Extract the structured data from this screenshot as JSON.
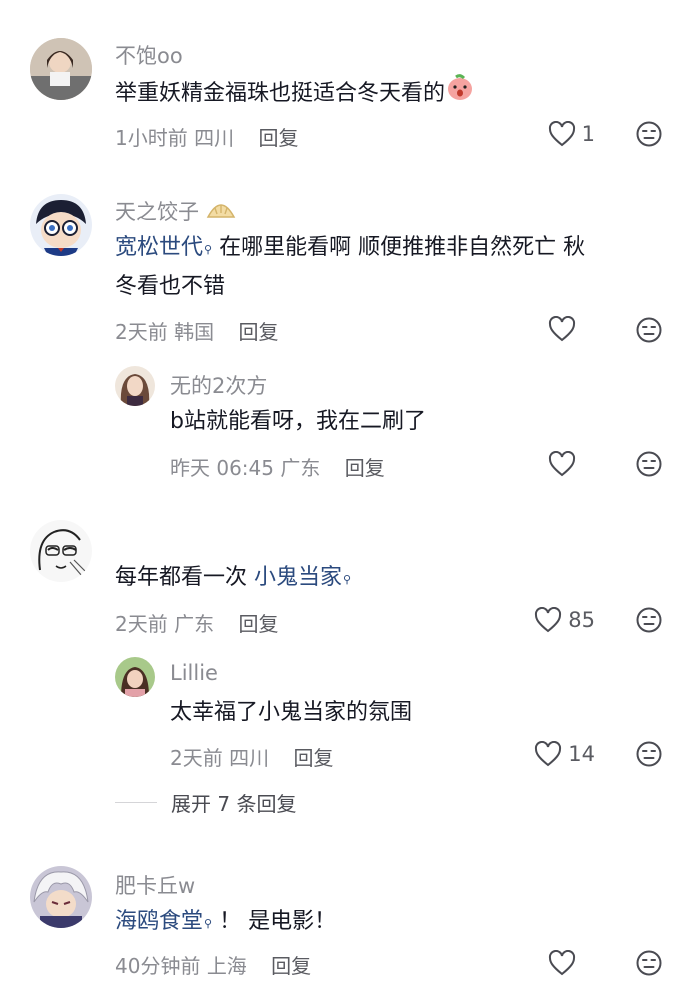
{
  "comments": [
    {
      "username": "不饱oo",
      "text": "举重妖精金福珠也挺适合冬天看的",
      "meta_time": "1小时前",
      "meta_loc": "四川",
      "reply": "回复",
      "likes": "1"
    },
    {
      "username": "天之饺子",
      "mention": "宽松世代",
      "text_line1": "在哪里能看啊 顺便推推非自然死亡 秋",
      "text_line2": "冬看也不错",
      "meta_time": "2天前",
      "meta_loc": "韩国",
      "reply": "回复",
      "likes": ""
    },
    {
      "username": "无的2次方",
      "text": "b站就能看呀，我在二刷了",
      "meta_time": "昨天 06:45",
      "meta_loc": "广东",
      "reply": "回复",
      "likes": ""
    },
    {
      "username": "",
      "text": "每年都看一次",
      "mention": "小鬼当家",
      "meta_time": "2天前",
      "meta_loc": "广东",
      "reply": "回复",
      "likes": "85"
    },
    {
      "username": "Lillie",
      "text": "太幸福了小鬼当家的氛围",
      "meta_time": "2天前",
      "meta_loc": "四川",
      "reply": "回复",
      "likes": "14"
    },
    {
      "username": "肥卡丘w",
      "mention": "海鸥食堂",
      "text": "！ 是电影！",
      "meta_time": "40分钟前",
      "meta_loc": "上海",
      "reply": "回复",
      "likes": ""
    }
  ],
  "expand_label": "展开 7 条回复",
  "icons": {
    "like": "heart-outline-icon",
    "dislike": "meh-face-icon",
    "mention": "search-small-icon"
  },
  "colors": {
    "text": "#161823",
    "meta": "#8a8b91",
    "mention": "#2b4a7e"
  }
}
